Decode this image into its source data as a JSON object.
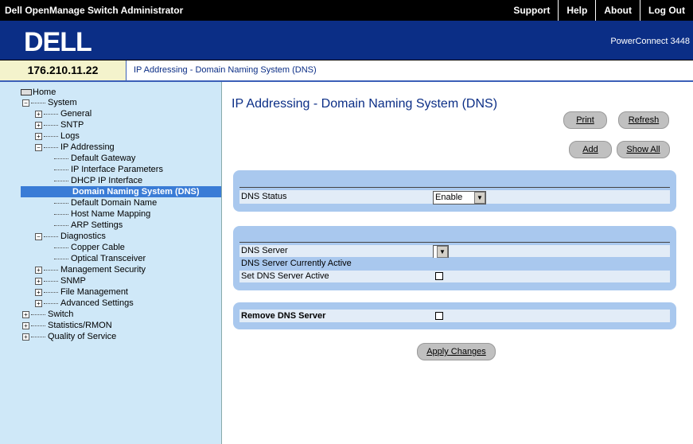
{
  "app": {
    "title": "Dell OpenManage Switch Administrator",
    "top_links": [
      "Support",
      "Help",
      "About",
      "Log Out"
    ],
    "logo": "DELL",
    "model": "PowerConnect 3448",
    "ip": "176.210.11.22",
    "breadcrumb": "IP Addressing - Domain Naming System (DNS)"
  },
  "tree": {
    "home": "Home",
    "system": "System",
    "general": "General",
    "sntp": "SNTP",
    "logs": "Logs",
    "ip_addressing": "IP Addressing",
    "default_gateway": "Default Gateway",
    "ip_interface_parameters": "IP Interface Parameters",
    "dhcp_ip_interface": "DHCP IP Interface",
    "dns": "Domain Naming System (DNS)",
    "default_domain_name": "Default Domain Name",
    "host_name_mapping": "Host Name Mapping",
    "arp_settings": "ARP Settings",
    "diagnostics": "Diagnostics",
    "copper_cable": "Copper Cable",
    "optical_transceiver": "Optical Transceiver",
    "management_security": "Management Security",
    "snmp": "SNMP",
    "file_management": "File Management",
    "advanced_settings": "Advanced Settings",
    "switch": "Switch",
    "statistics_rmon": "Statistics/RMON",
    "quality_of_service": "Quality of Service"
  },
  "main": {
    "title": "IP Addressing - Domain Naming System (DNS)",
    "print": "Print",
    "refresh": "Refresh",
    "add": "Add",
    "show_all": "Show All",
    "dns_status_label": "DNS Status",
    "dns_status_value": "Enable",
    "dns_server_label": "DNS Server",
    "dns_server_value": "",
    "dns_active_label": "DNS Server Currently Active",
    "set_active_label": "Set DNS Server Active",
    "remove_label": "Remove DNS Server",
    "apply": "Apply Changes"
  }
}
